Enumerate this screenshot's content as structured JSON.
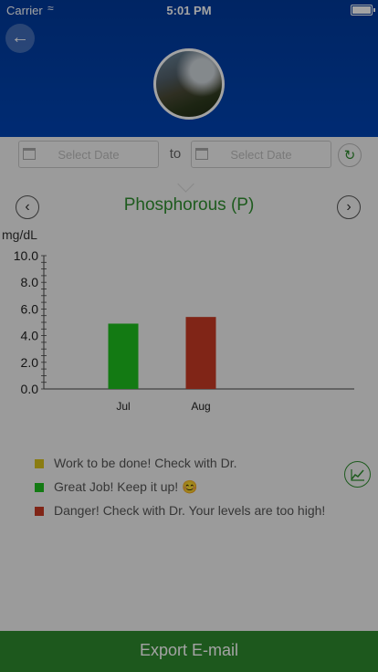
{
  "status_bar": {
    "carrier": "Carrier",
    "time": "5:01 PM"
  },
  "header": {
    "back_icon": "arrow-left-icon",
    "avatar_alt": "profile-photo"
  },
  "date_filter": {
    "from_placeholder": "Select Date",
    "to_label": "to",
    "to_placeholder": "Select Date",
    "refresh_icon": "refresh-icon"
  },
  "title_bar": {
    "title": "Phosphorous (P)",
    "prev_icon": "chevron-left-icon",
    "next_icon": "chevron-right-icon"
  },
  "chart_data": {
    "type": "bar",
    "ylabel": "mg/dL",
    "categories": [
      "Jul",
      "Aug"
    ],
    "values": [
      4.9,
      5.4
    ],
    "bar_colors": [
      "#1fbf1f",
      "#c93a24"
    ],
    "ylim": [
      0,
      10
    ],
    "yticks": [
      "10.0",
      "8.0",
      "6.0",
      "4.0",
      "2.0",
      "0.0"
    ],
    "grid": false
  },
  "legend": [
    {
      "color": "#d8c21b",
      "text": "Work to be done! Check with Dr."
    },
    {
      "color": "#1fbf1f",
      "text": "Great Job! Keep it up! 😊"
    },
    {
      "color": "#c93a24",
      "text": "Danger! Check with Dr. Your levels are too high!"
    }
  ],
  "export_button": {
    "label": "Export E-mail"
  },
  "colors": {
    "header": "#0044b4",
    "accent": "#2f8f2f",
    "export": "#2e8a2e"
  }
}
